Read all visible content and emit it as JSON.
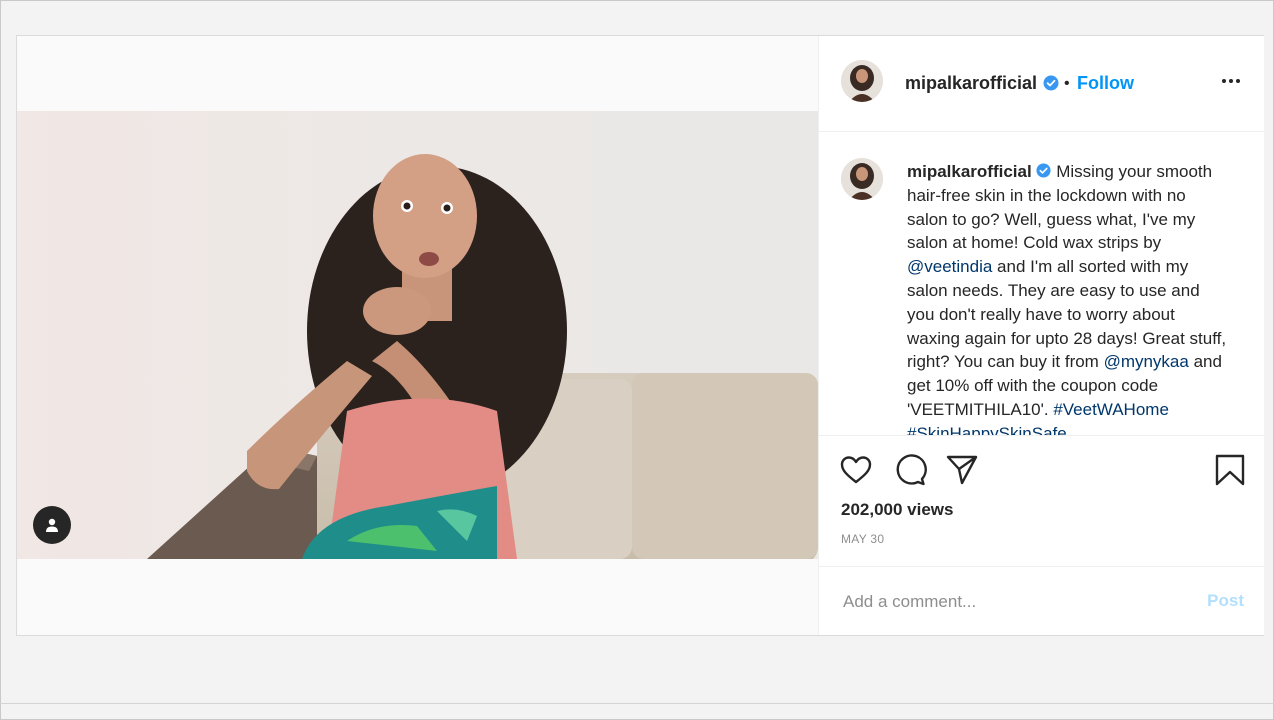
{
  "post": {
    "username": "mipalkarofficial",
    "follow_label": "Follow",
    "separator": "•",
    "caption_parts": [
      "Missing your smooth hair-free skin in the lockdown with no salon to go? Well, guess what, I've my salon at home! Cold wax strips by ",
      "@veetindia",
      " and I'm all sorted with my salon needs. They are easy to use and you don't really have to worry about waxing again for upto 28 days! Great stuff, right? You can buy it from ",
      "@mynykaa",
      " and get 10% off with the coupon code 'VEETMITHILA10'. ",
      "#VeetWAHome #SkinHappySkinSafe"
    ],
    "views": "202,000 views",
    "date": "MAY 30",
    "comment_placeholder": "Add a comment...",
    "post_label": "Post"
  },
  "icons": {
    "like": "heart-icon",
    "comment": "comment-bubble-icon",
    "share": "paper-plane-icon",
    "save": "bookmark-icon",
    "more": "more-options-icon",
    "verified": "verified-badge-icon",
    "tagged_user": "user-tag-icon"
  },
  "colors": {
    "accent": "#0095f6",
    "mention": "#00376b",
    "verified": "#3897f0",
    "muted": "#8e8e8e"
  }
}
